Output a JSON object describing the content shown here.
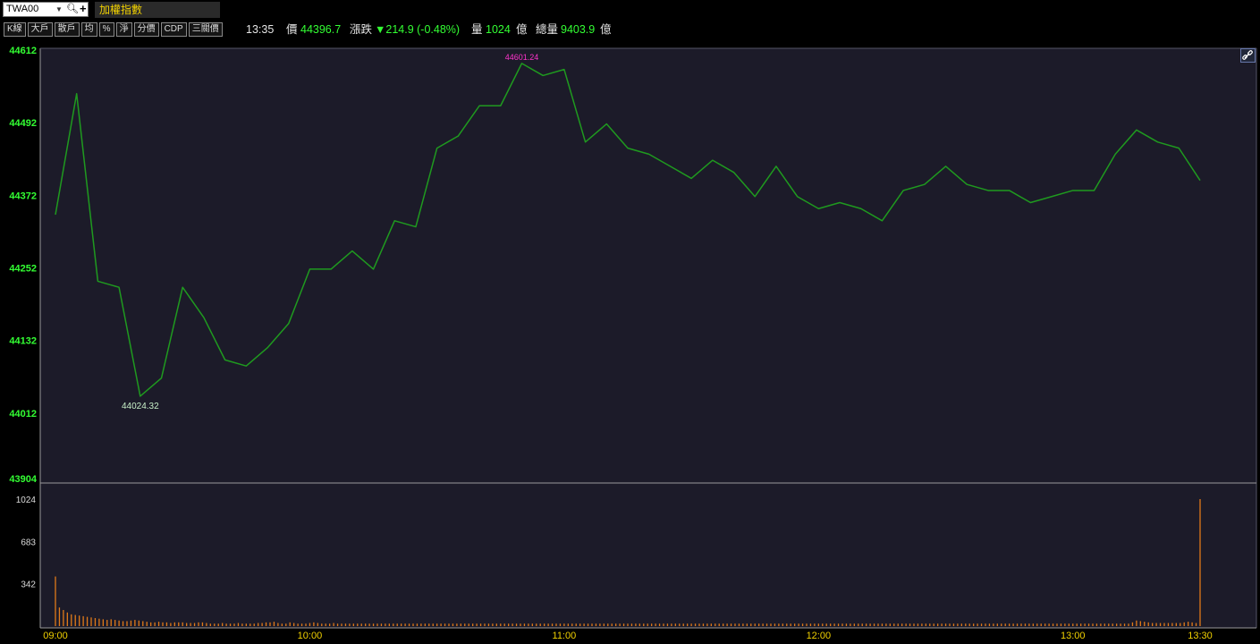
{
  "header": {
    "symbol": "TWA00",
    "name": "加權指數",
    "time": "13:35",
    "price_label": "價",
    "price": "44396.7",
    "change_label": "漲跌",
    "change": "▼214.9 (-0.48%)",
    "volume_label": "量",
    "volume": "1024",
    "volume_unit": "億",
    "total_label": "總量",
    "total": "9403.9",
    "total_unit": "億"
  },
  "toolbar": [
    "K線",
    "大戶",
    "散戶",
    "均",
    "%",
    "淨",
    "分價",
    "CDP",
    "三關價"
  ],
  "icons": {
    "dropdown": "chevron-down-icon",
    "search": "search-icon",
    "add": "plus-icon",
    "link": "link-icon"
  },
  "colors": {
    "price_line": "#1f9a1f",
    "volume_bar": "#e07a1a",
    "up_text": "#33ff33",
    "axis_time": "#f0d000",
    "high_marker": "#ff33cc"
  },
  "chart_data": {
    "type": "line",
    "price": {
      "y_ticks": [
        44612,
        44492,
        44372,
        44252,
        44132,
        44012,
        43904
      ],
      "ylim": [
        43904,
        44612
      ],
      "low_label": "44024.32",
      "high_label": "44601.24",
      "times": [
        "09:00",
        "09:05",
        "09:10",
        "09:15",
        "09:20",
        "09:25",
        "09:30",
        "09:35",
        "09:40",
        "09:45",
        "09:50",
        "09:55",
        "10:00",
        "10:05",
        "10:10",
        "10:15",
        "10:20",
        "10:25",
        "10:30",
        "10:35",
        "10:40",
        "10:45",
        "10:50",
        "10:55",
        "11:00",
        "11:05",
        "11:10",
        "11:15",
        "11:20",
        "11:25",
        "11:30",
        "11:35",
        "11:40",
        "11:45",
        "11:50",
        "11:55",
        "12:00",
        "12:05",
        "12:10",
        "12:15",
        "12:20",
        "12:25",
        "12:30",
        "12:35",
        "12:40",
        "12:45",
        "12:50",
        "12:55",
        "13:00",
        "13:05",
        "13:10",
        "13:15",
        "13:20",
        "13:25",
        "13:30"
      ],
      "values": [
        44340,
        44540,
        44230,
        44220,
        44040,
        44070,
        44220,
        44170,
        44100,
        44090,
        44120,
        44160,
        44250,
        44250,
        44280,
        44250,
        44330,
        44320,
        44450,
        44470,
        44520,
        44520,
        44590,
        44570,
        44580,
        44460,
        44490,
        44450,
        44440,
        44420,
        44400,
        44430,
        44410,
        44370,
        44420,
        44370,
        44350,
        44360,
        44350,
        44330,
        44380,
        44390,
        44420,
        44390,
        44380,
        44380,
        44360,
        44370,
        44380,
        44380,
        44440,
        44480,
        44460,
        44450,
        44396.7
      ]
    },
    "volume": {
      "y_ticks": [
        1024,
        683,
        342
      ],
      "ylim": [
        0,
        1024
      ],
      "values": [
        400,
        150,
        130,
        110,
        95,
        90,
        85,
        80,
        75,
        70,
        65,
        60,
        55,
        50,
        55,
        50,
        45,
        40,
        40,
        45,
        50,
        45,
        40,
        35,
        30,
        30,
        35,
        30,
        30,
        25,
        30,
        30,
        30,
        25,
        25,
        25,
        30,
        30,
        25,
        20,
        20,
        20,
        25,
        20,
        20,
        20,
        25,
        20,
        20,
        20,
        20,
        25,
        25,
        30,
        30,
        35,
        25,
        20,
        20,
        30,
        25,
        20,
        20,
        20,
        25,
        30,
        25,
        20,
        20,
        20,
        25,
        20,
        20,
        20,
        20,
        20,
        20,
        20,
        20,
        20,
        20,
        20,
        20,
        20,
        20,
        20,
        20,
        20,
        20,
        20,
        20,
        20,
        20,
        20,
        20,
        20,
        20,
        20,
        20,
        20,
        20,
        20,
        20,
        20,
        20,
        20,
        20,
        20,
        20,
        20,
        20,
        20,
        20,
        20,
        20,
        20,
        20,
        20,
        20,
        20,
        20,
        20,
        20,
        20,
        20,
        20,
        20,
        20,
        20,
        20,
        20,
        20,
        20,
        20,
        20,
        20,
        20,
        20,
        20,
        20,
        20,
        20,
        20,
        20,
        20,
        20,
        20,
        20,
        20,
        20,
        20,
        20,
        20,
        20,
        20,
        20,
        20,
        20,
        20,
        20,
        20,
        20,
        20,
        20,
        20,
        20,
        20,
        20,
        20,
        20,
        20,
        20,
        20,
        20,
        20,
        20,
        20,
        20,
        20,
        20,
        20,
        20,
        20,
        20,
        20,
        20,
        20,
        20,
        20,
        20,
        20,
        20,
        20,
        20,
        20,
        20,
        20,
        20,
        20,
        20,
        20,
        20,
        20,
        20,
        20,
        20,
        20,
        20,
        20,
        20,
        20,
        20,
        20,
        20,
        20,
        20,
        20,
        20,
        20,
        20,
        20,
        20,
        20,
        20,
        20,
        20,
        20,
        20,
        20,
        20,
        20,
        20,
        20,
        20,
        20,
        20,
        20,
        20,
        20,
        20,
        20,
        20,
        20,
        20,
        20,
        20,
        20,
        20,
        20,
        20,
        20,
        20,
        20,
        20,
        20,
        20,
        20,
        20,
        20,
        20,
        20,
        20,
        20,
        20,
        20,
        20,
        20,
        20,
        20,
        20,
        20,
        30,
        45,
        40,
        35,
        30,
        25,
        25,
        25,
        25,
        25,
        25,
        25,
        25,
        30,
        35,
        30,
        25,
        1024
      ]
    },
    "x_ticks": [
      "09:00",
      "10:00",
      "11:00",
      "12:00",
      "13:00",
      "13:30"
    ]
  }
}
